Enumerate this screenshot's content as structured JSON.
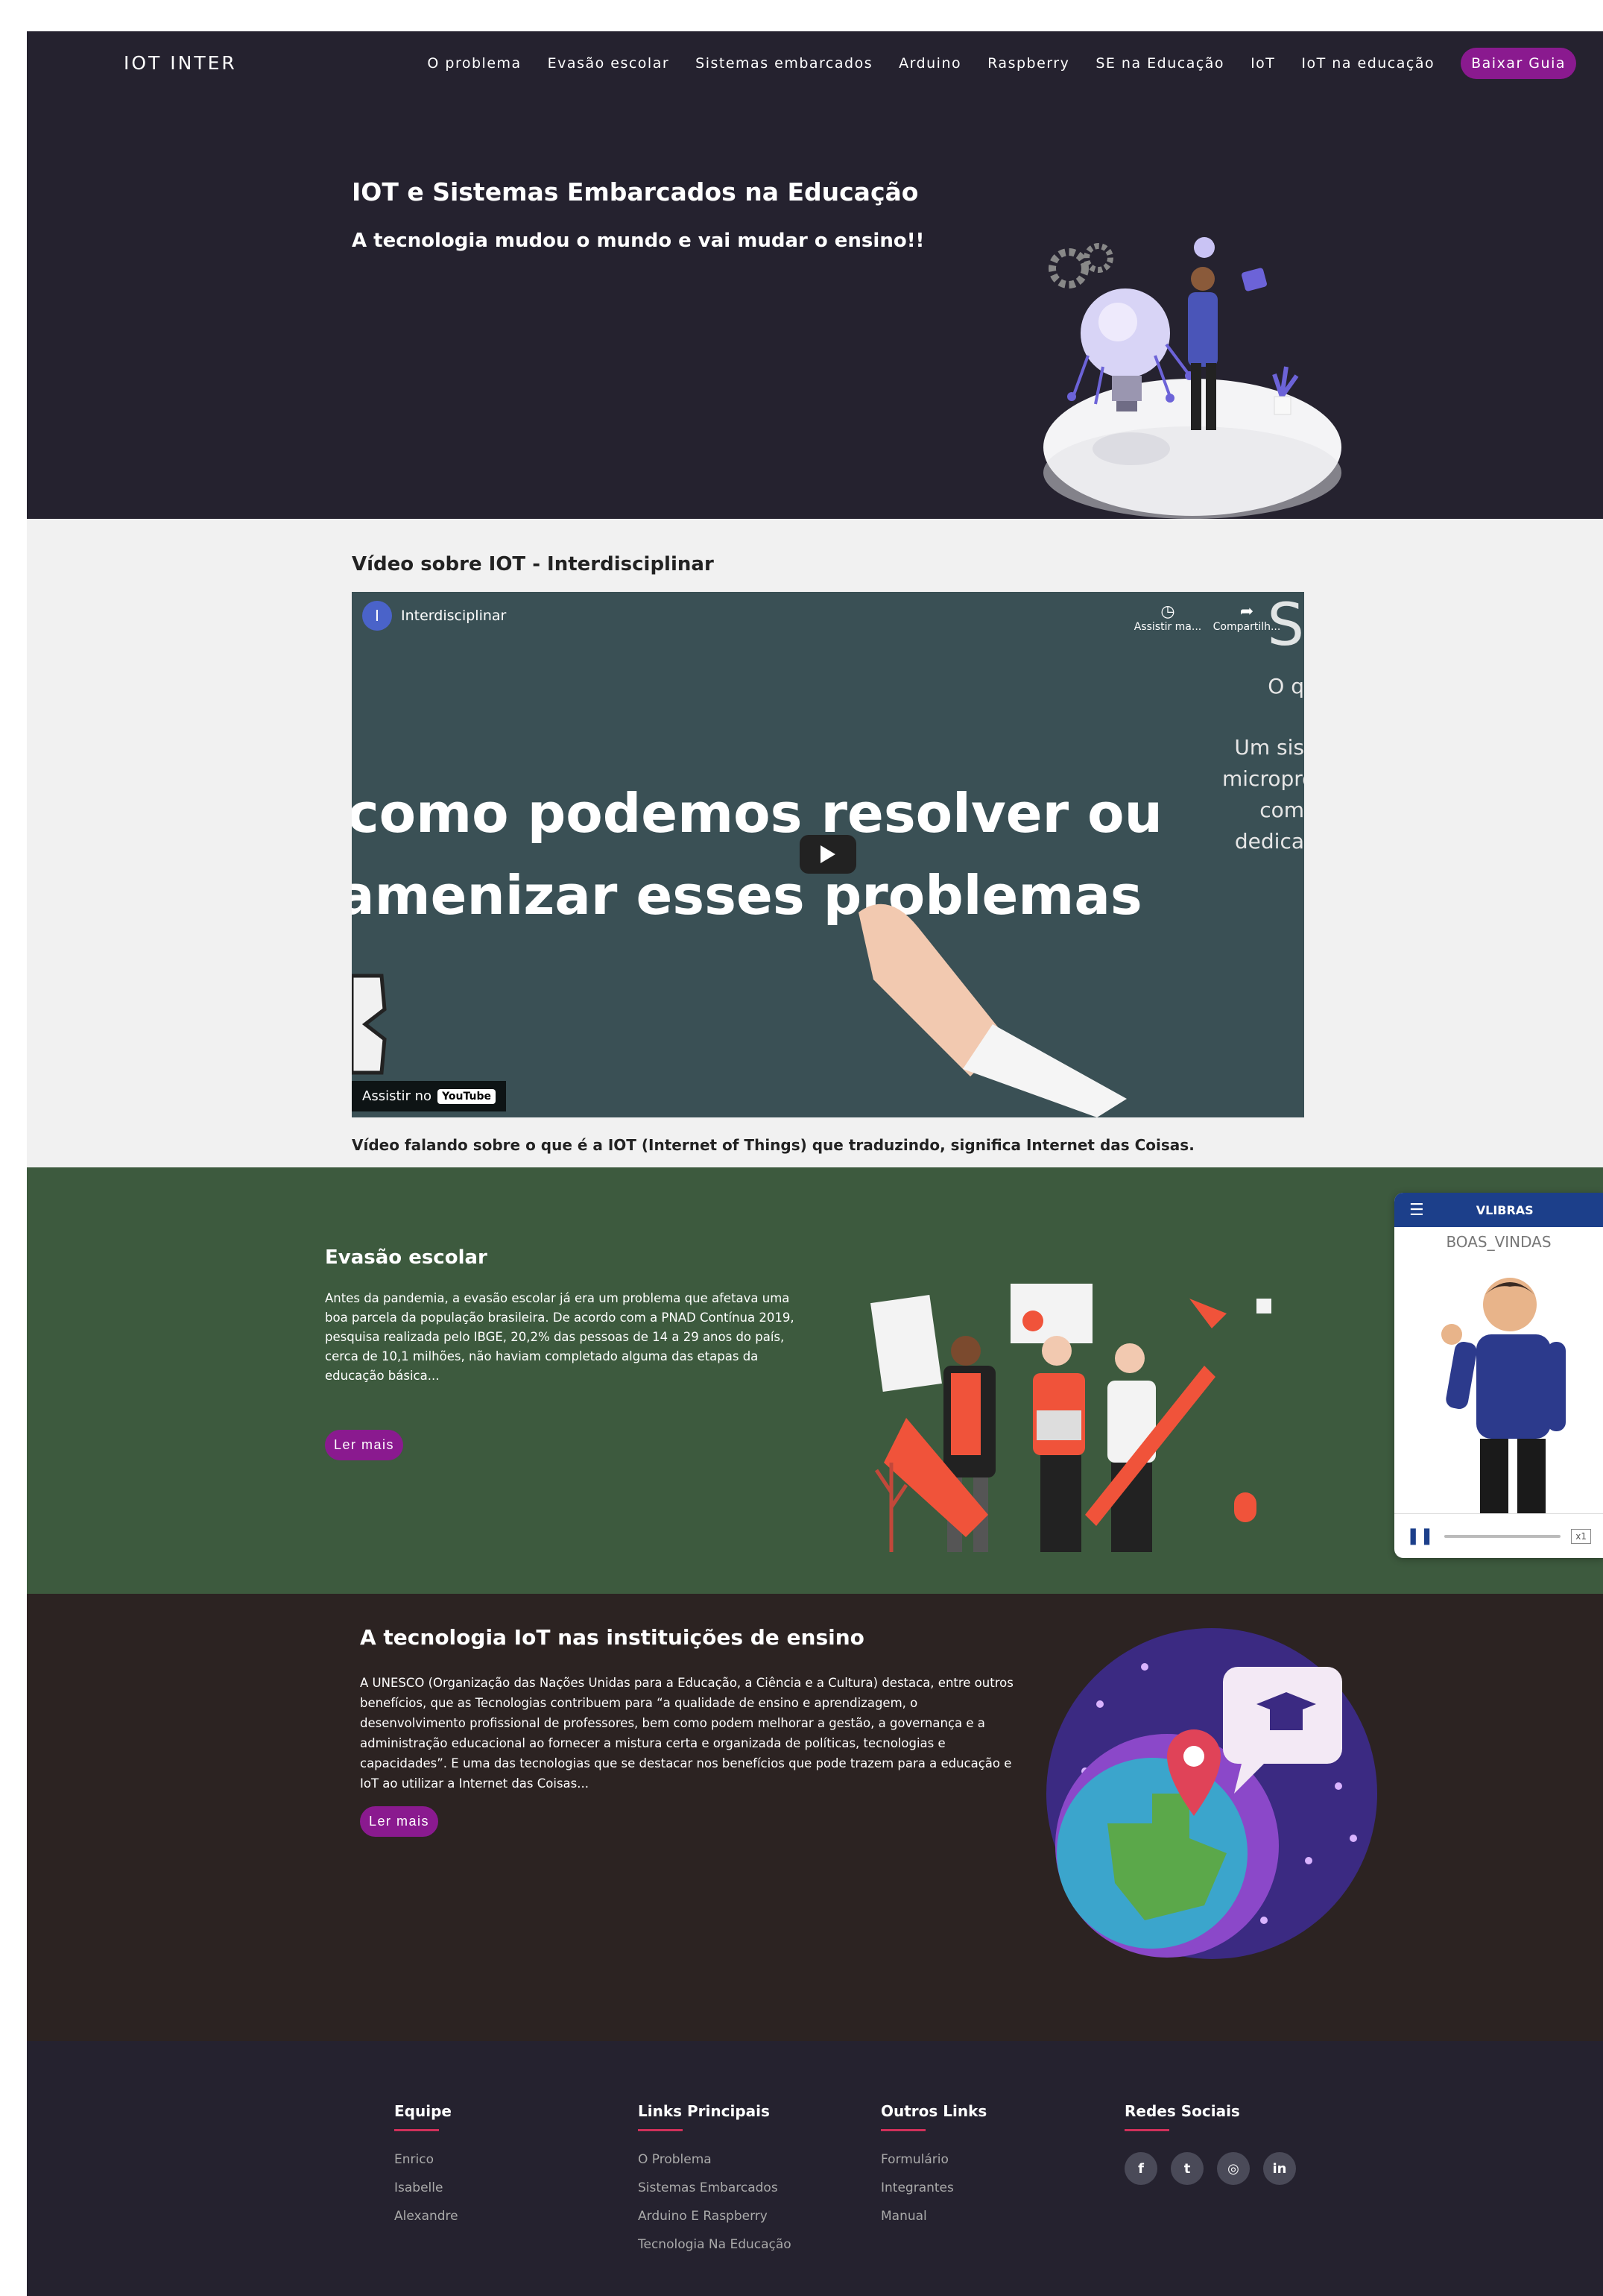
{
  "nav": {
    "brand": "IOT INTER",
    "items": [
      "O problema",
      "Evasão escolar",
      "Sistemas embarcados",
      "Arduino",
      "Raspberry",
      "SE na Educação",
      "IoT",
      "IoT na educação"
    ],
    "cta": "Baixar Guia"
  },
  "hero": {
    "title": "IOT e Sistemas Embarcados na Educação",
    "subtitle": "A tecnologia mudou o mundo e vai mudar o ensino!!"
  },
  "video": {
    "section_title": "Vídeo sobre IOT - Interdisciplinar",
    "channel_initial": "I",
    "channel_name": "Interdisciplinar",
    "watch_later": "Assistir ma...",
    "share": "Compartilh...",
    "line1": "como podemos resolver ou",
    "line2": "amenizar esses problemas",
    "side_s": "S",
    "side_1": "O q",
    "side_2": "Um sis",
    "side_3": "micropro",
    "side_4": "com",
    "side_5": "dedica",
    "watch_on": "Assistir no",
    "yt_label": "YouTube",
    "caption": "Vídeo falando sobre o que é a IOT (Internet of Things) que traduzindo, significa Internet das Coisas."
  },
  "evasao": {
    "title": "Evasão escolar",
    "text": "Antes da pandemia, a evasão escolar já era um problema que afetava uma boa parcela da população brasileira. De acordo com a PNAD Contínua 2019, pesquisa realizada pelo IBGE, 20,2% das pessoas de 14 a 29 anos do país, cerca de 10,1 milhões, não haviam completado alguma das etapas da educação básica...",
    "button": "Ler mais"
  },
  "vlibras": {
    "title": "VLIBRAS",
    "word": "BOAS_VINDAS",
    "speed": "x1"
  },
  "tecnologia": {
    "title": "A tecnologia IoT nas instituições de ensino",
    "text": "A UNESCO (Organização das Nações Unidas para a Educação, a Ciência e a Cultura) destaca, entre outros benefícios, que as Tecnologias contribuem para “a qualidade de ensino e aprendizagem, o desenvolvimento profissional de professores, bem como podem melhorar a gestão, a governança e a administração educacional ao fornecer a mistura certa e organizada de políticas, tecnologias e capacidades”. E uma das tecnologias que se destacar nos benefícios que pode trazem para a educação e IoT ao utilizar a Internet das Coisas...",
    "button": "Ler mais"
  },
  "footer": {
    "equipe": {
      "title": "Equipe",
      "links": [
        "Enrico",
        "Isabelle",
        "Alexandre"
      ]
    },
    "principais": {
      "title": "Links Principais",
      "links": [
        "O Problema",
        "Sistemas Embarcados",
        "Arduino E Raspberry",
        "Tecnologia Na Educação"
      ]
    },
    "outros": {
      "title": "Outros Links",
      "links": [
        "Formulário",
        "Integrantes",
        "Manual"
      ]
    },
    "redes": {
      "title": "Redes Sociais",
      "icons": [
        "facebook-icon",
        "twitter-icon",
        "instagram-icon",
        "linkedin-icon"
      ],
      "glyphs": [
        "f",
        "t",
        "◎",
        "in"
      ]
    }
  },
  "colors": {
    "dark_nav": "#25222f",
    "light_section": "#f1f1f1",
    "green_section": "#3d5a3e",
    "brown_section": "#2c2322",
    "accent_purple": "#8a1a8f",
    "footer_underline": "#d0305a"
  }
}
